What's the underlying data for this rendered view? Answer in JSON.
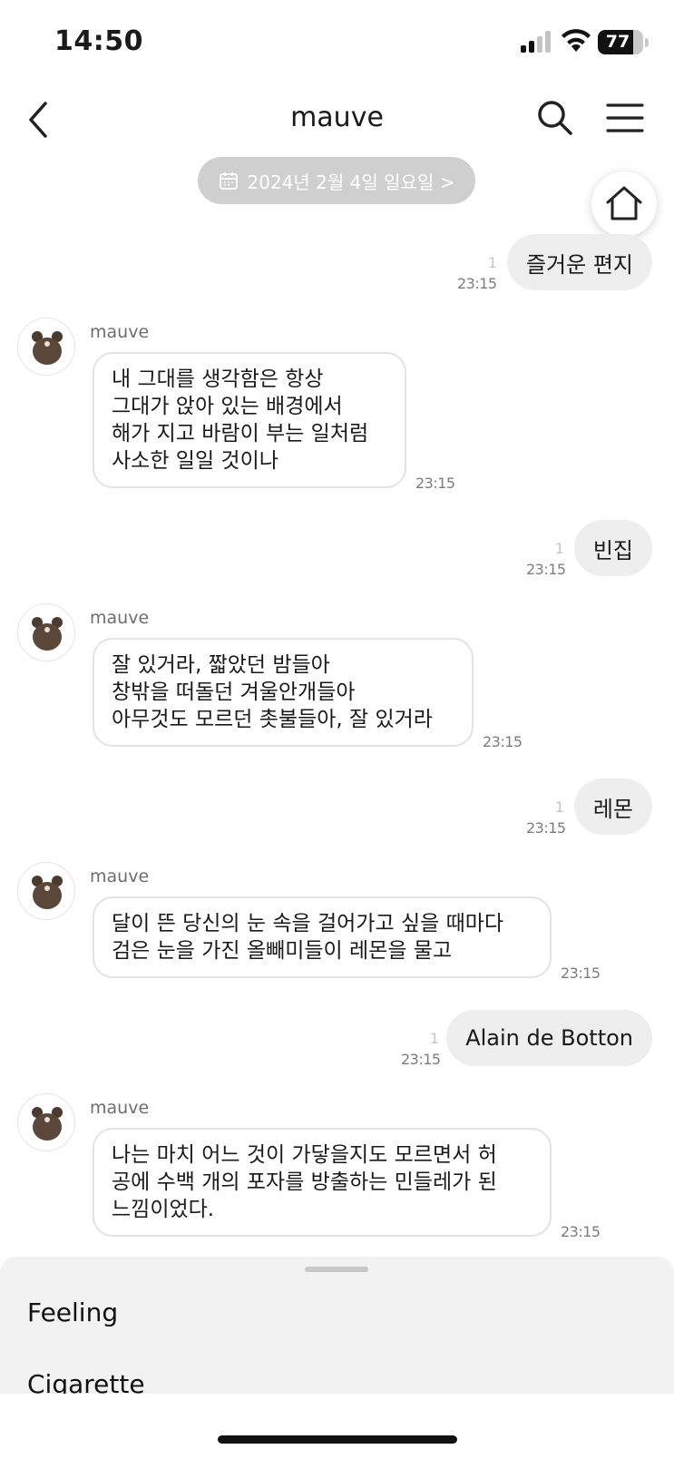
{
  "status_bar": {
    "time": "14:50",
    "battery": "77",
    "battery_level": 0.77
  },
  "nav": {
    "title": "mauve"
  },
  "date_pill": {
    "label": "2024년 2월 4일 일요일 >"
  },
  "messages": [
    {
      "dir": "out",
      "text": "즐거운 편지",
      "read": "1",
      "time": "23:15"
    },
    {
      "dir": "in",
      "sender": "mauve",
      "lines": [
        "내 그대를 생각함은 항상",
        "그대가 앉아 있는 배경에서",
        "해가 지고 바람이 부는 일처럼",
        "사소한 일일 것이나"
      ],
      "time": "23:15"
    },
    {
      "dir": "out",
      "text": "빈집",
      "read": "1",
      "time": "23:15"
    },
    {
      "dir": "in",
      "sender": "mauve",
      "lines": [
        "잘 있거라, 짧았던 밤들아",
        "창밖을 떠돌던 겨울안개들아",
        "아무것도 모르던 촛불들아, 잘 있거라"
      ],
      "time": "23:15"
    },
    {
      "dir": "out",
      "text": "레몬",
      "read": "1",
      "time": "23:15"
    },
    {
      "dir": "in",
      "sender": "mauve",
      "lines": [
        "달이 뜬 당신의 눈 속을 걸어가고 싶을 때마다",
        "검은 눈을 가진 올빼미들이 레몬을 물고"
      ],
      "time": "23:15"
    },
    {
      "dir": "out",
      "text": "Alain de Botton",
      "read": "1",
      "time": "23:15"
    },
    {
      "dir": "in",
      "sender": "mauve",
      "lines": [
        "나는 마치 어느 것이 가닿을지도 모르면서 허",
        "공에 수백 개의 포자를 방출하는 민들레가 된",
        "느낌이었다."
      ],
      "time": "23:15"
    }
  ],
  "sheet": {
    "items": [
      "Feeling",
      "Cigarette"
    ]
  },
  "colors": {
    "bubble_out": "#eeeeee",
    "date_pill": "#cfcfcf",
    "sheet": "#f2f2f2"
  }
}
